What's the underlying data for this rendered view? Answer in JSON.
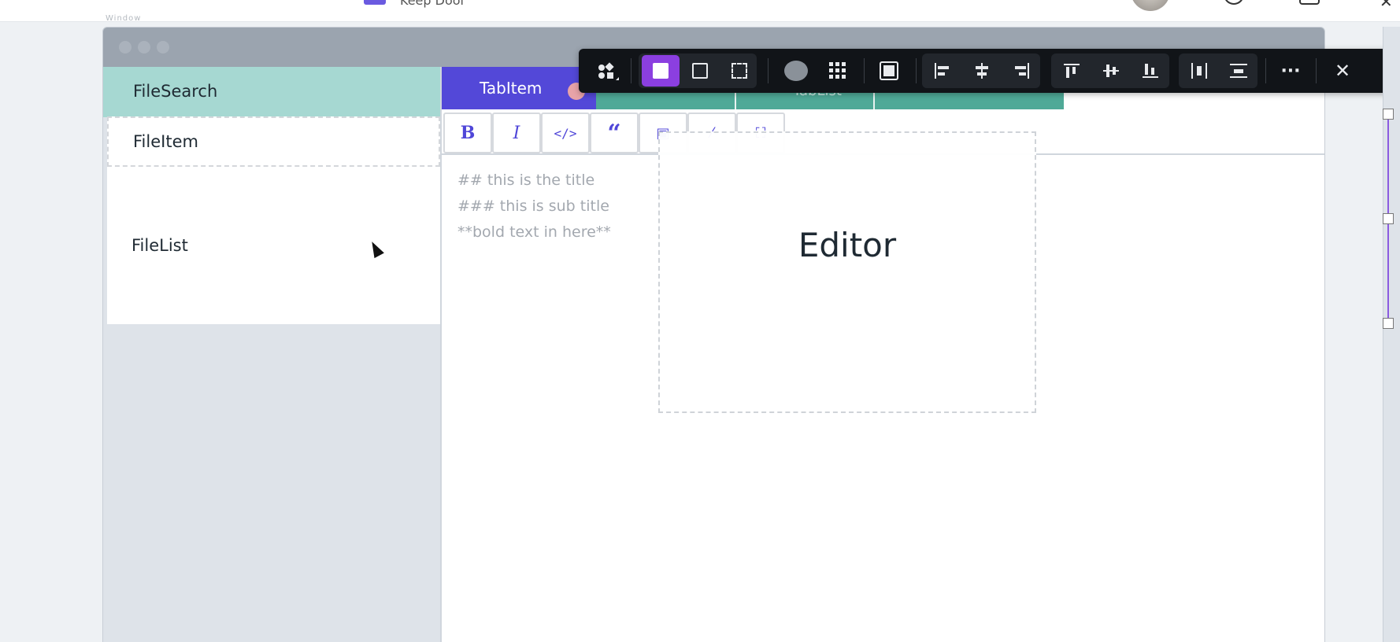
{
  "appbar": {
    "window_label": "Window",
    "doc_title": "Keep Dool"
  },
  "sidebar": {
    "search_label": "FileSearch",
    "file_item_label": "FileItem",
    "file_list_label": "FileList"
  },
  "tabs": {
    "active_label": "TabItem",
    "tablist_label": "TabList"
  },
  "format_buttons": [
    "bold",
    "italic",
    "code",
    "quote",
    "image",
    "link",
    "fullscreen"
  ],
  "markdown": {
    "line1": "## this is the title",
    "line2": "### this is sub title",
    "line3": "**bold text in here**"
  },
  "editor_label": "Editor",
  "toolbar": {
    "groups": [
      "component-insert",
      "fill",
      "stroke",
      "dashed-select",
      "shape-color",
      "grid",
      "layout",
      "align-left",
      "align-center",
      "align-right",
      "align-top",
      "align-middle",
      "align-bottom",
      "distribute-h",
      "distribute-v",
      "more",
      "close"
    ]
  },
  "colors": {
    "accent": "#5348d8",
    "teal": "#4fa997",
    "search_bg": "#a6d8d2",
    "toolbar_bg": "#111418",
    "selected_tool": "#8b3fe0"
  }
}
